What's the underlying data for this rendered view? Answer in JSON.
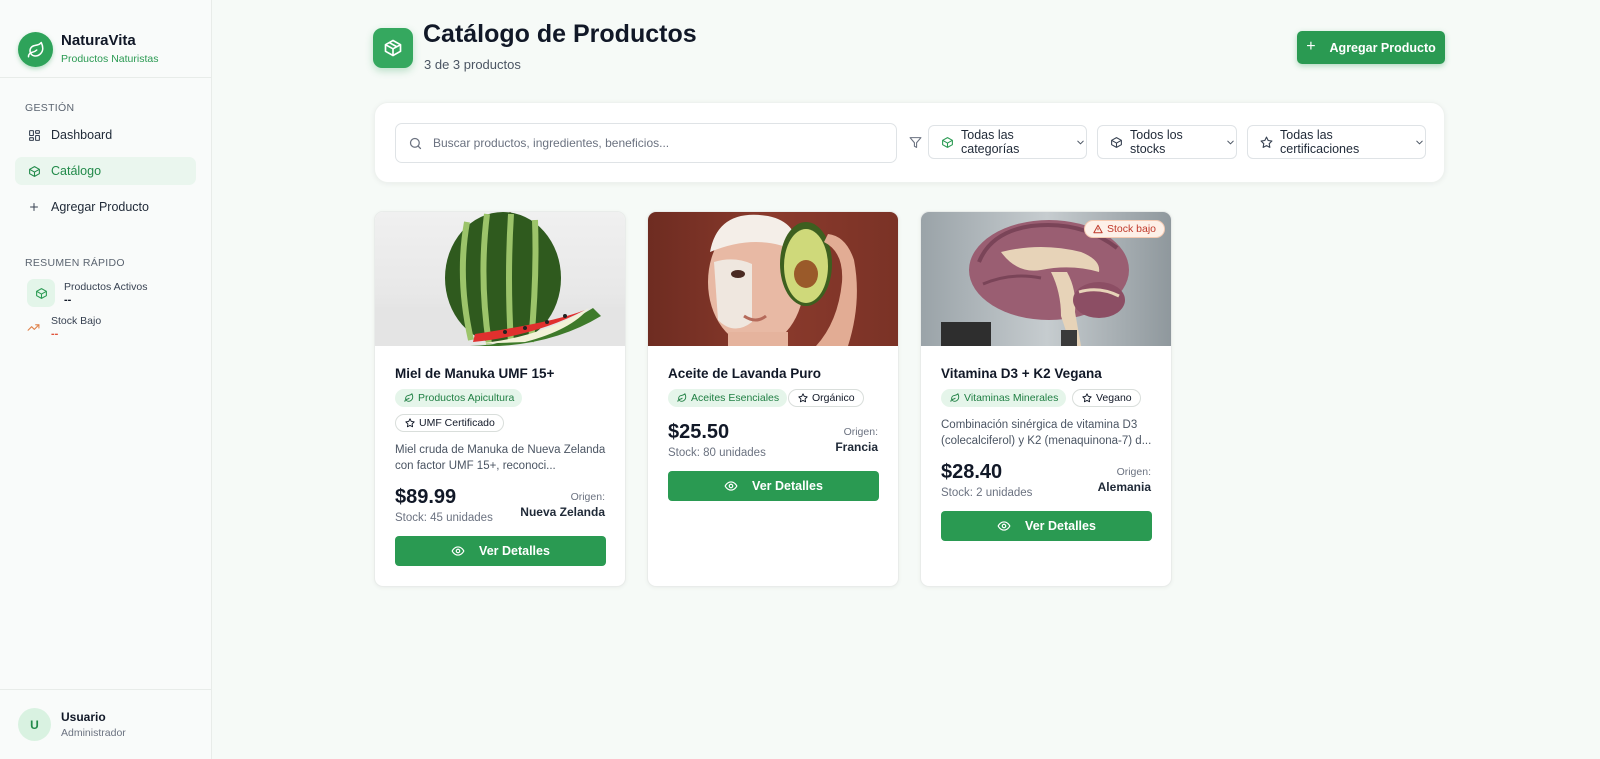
{
  "brand": {
    "name": "NaturaVita",
    "subtitle": "Productos Naturistas"
  },
  "sidebar": {
    "section_label": "GESTIÓN",
    "items": [
      {
        "label": "Dashboard",
        "icon": "dashboard-icon"
      },
      {
        "label": "Catálogo",
        "icon": "package-icon",
        "active": true
      },
      {
        "label": "Agregar Producto",
        "icon": "plus-icon"
      }
    ],
    "summary_label": "RESUMEN RÁPIDO",
    "summary": [
      {
        "label": "Productos Activos",
        "value": "--"
      },
      {
        "label": "Stock Bajo",
        "value": "--"
      }
    ]
  },
  "user": {
    "initial": "U",
    "name": "Usuario",
    "role": "Administrador"
  },
  "header": {
    "title": "Catálogo de Productos",
    "subtitle": "3 de 3 productos",
    "add_button": "Agregar Producto"
  },
  "filters": {
    "search_placeholder": "Buscar productos, ingredientes, beneficios...",
    "category": "Todas las categorías",
    "stock": "Todos los stocks",
    "certification": "Todas las certificaciones"
  },
  "products": [
    {
      "name": "Miel de Manuka UMF 15+",
      "category": "Productos Apicultura",
      "certification": "UMF Certificado",
      "description": "Miel cruda de Manuka de Nueva Zelanda con factor UMF 15+, reconoci...",
      "price": "$89.99",
      "stock": "Stock: 45 unidades",
      "origin_label": "Origen:",
      "origin": "Nueva Zelanda",
      "button": "Ver Detalles"
    },
    {
      "name": "Aceite de Lavanda Puro",
      "category": "Aceites Esenciales",
      "certification": "Orgánico",
      "description": "",
      "price": "$25.50",
      "stock": "Stock: 80 unidades",
      "origin_label": "Origen:",
      "origin": "Francia",
      "button": "Ver Detalles"
    },
    {
      "name": "Vitamina D3 + K2 Vegana",
      "category": "Vitaminas Minerales",
      "certification": "Vegano",
      "description": "Combinación sinérgica de vitamina D3 (colecalciferol) y K2 (menaquinona-7) d...",
      "price": "$28.40",
      "stock": "Stock: 2 unidades",
      "origin_label": "Origen:",
      "origin": "Alemania",
      "button": "Ver Detalles",
      "low_stock_badge": "Stock bajo"
    }
  ],
  "colors": {
    "primary": "#2a9a52",
    "primary_light": "#e5f5ea",
    "warning": "#c0392b"
  }
}
